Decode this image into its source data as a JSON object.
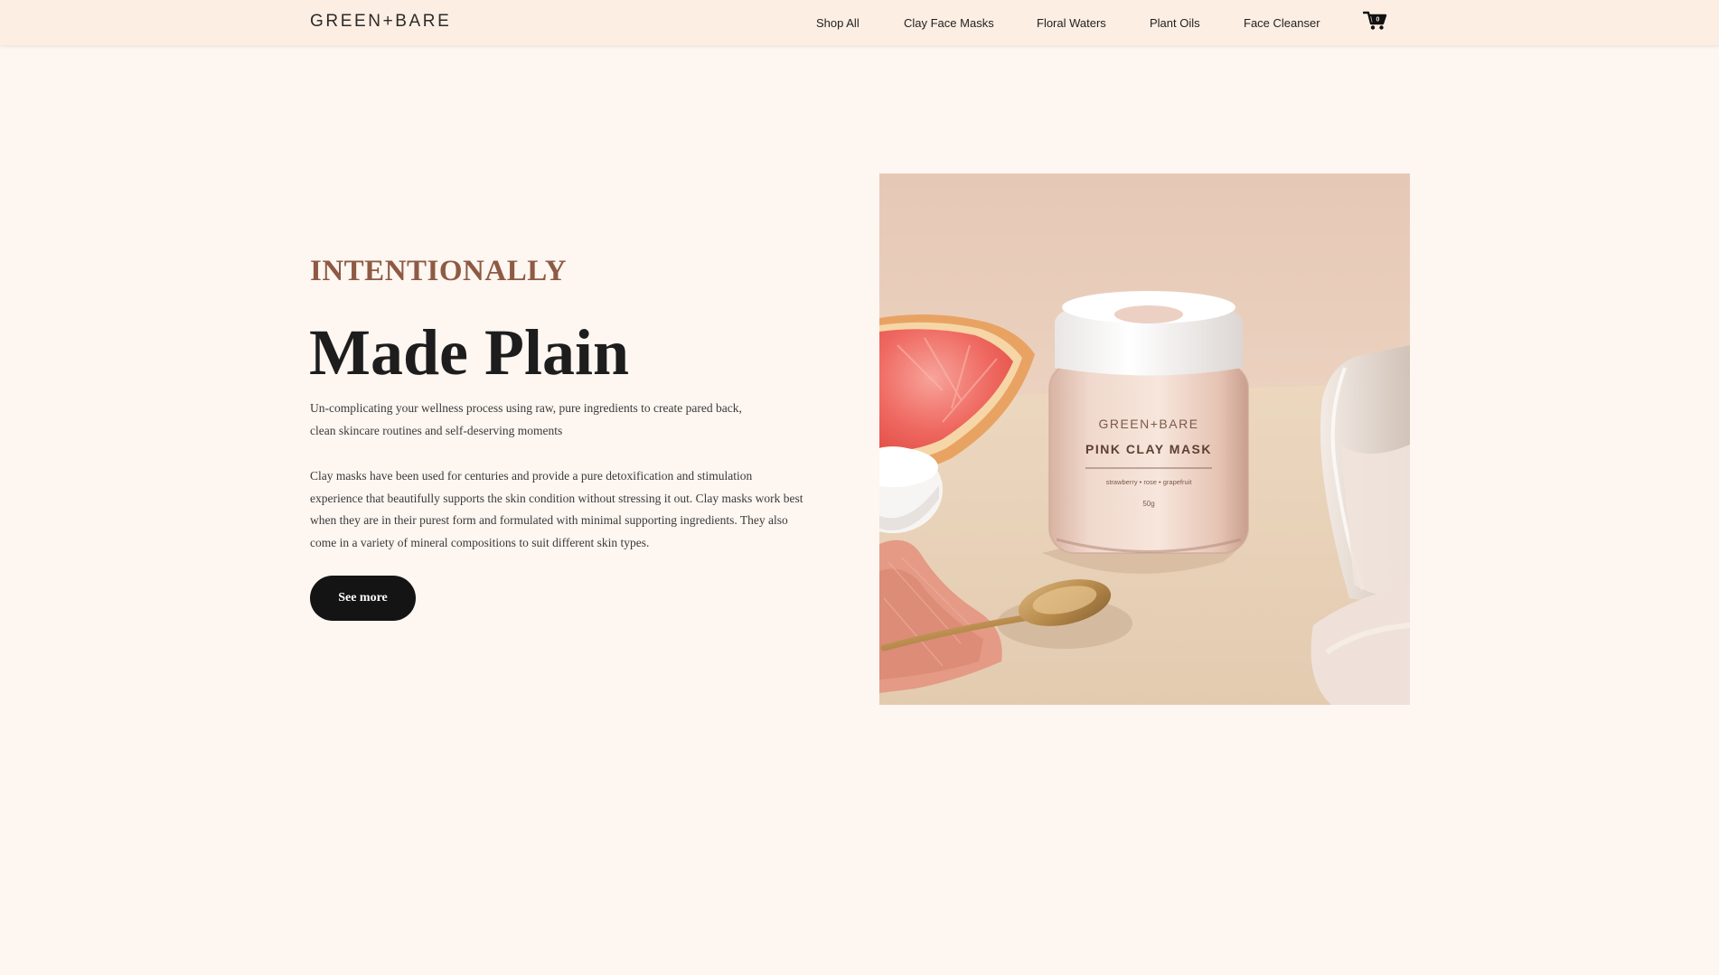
{
  "header": {
    "logo": "GREEN+BARE",
    "nav": [
      {
        "label": "Shop All"
      },
      {
        "label": "Clay Face Masks"
      },
      {
        "label": "Floral Waters"
      },
      {
        "label": "Plant Oils"
      },
      {
        "label": "Face Cleanser"
      }
    ],
    "cart_icon": "shopping-cart-icon"
  },
  "hero": {
    "eyebrow": "INTENTIONALLY",
    "headline": "Made Plain",
    "intro_line_1": "Un-complicating your wellness process using raw, pure ingredients to create pared back,",
    "intro_line_2": "clean skincare routines and self-deserving moments",
    "body_line_1": "Clay masks have been used for centuries and provide a pure detoxification and stimulation",
    "body_line_2": "experience that beautifully supports the skin condition without stressing it out. Clay masks work best",
    "body_line_3": "when they are in their purest form and formulated with minimal supporting ingredients. They also",
    "body_line_4": "come in a variety of mineral compositions to suit different skin types.",
    "cta_label": "See more"
  },
  "product_image": {
    "jar_brand": "GREEN+BARE",
    "jar_product": "PINK CLAY MASK",
    "jar_ingredients": "strawberry • rose • grapefruit",
    "jar_weight": "50g"
  },
  "colors": {
    "page_bg": "#fdf6f1",
    "header_bg": "#fdeee3",
    "eyebrow": "#8e5a43",
    "button_bg": "#141414"
  }
}
